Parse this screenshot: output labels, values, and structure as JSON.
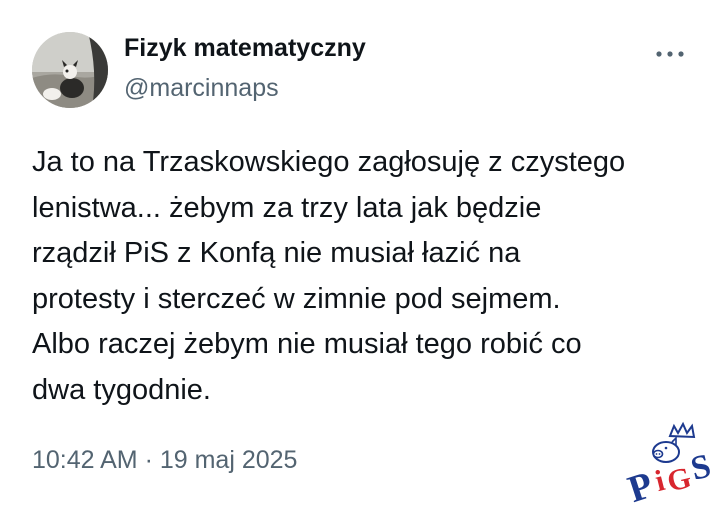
{
  "author": {
    "name": "Fizyk matematyczny",
    "handle": "@marcinnaps"
  },
  "more_icon": "more-horizontal-icon",
  "tweet": {
    "lines": [
      "Ja to na Trzaskowskiego zagłosuję z czystego",
      "lenistwa... żebym za trzy lata jak będzie",
      "rządził PiS z Konfą nie musiał łazić na",
      "protesty i sterczeć w zimnie pod sejmem.",
      "Albo raczej żebym nie musiał tego robić co",
      "dwa tygodnie."
    ]
  },
  "timestamp": "10:42 AM · 19 maj 2025",
  "watermark": {
    "text": "PiGS"
  },
  "colors": {
    "text_primary": "#0f1419",
    "text_secondary": "#536471",
    "logo_blue": "#1d3a8f",
    "logo_red": "#d8262e"
  }
}
